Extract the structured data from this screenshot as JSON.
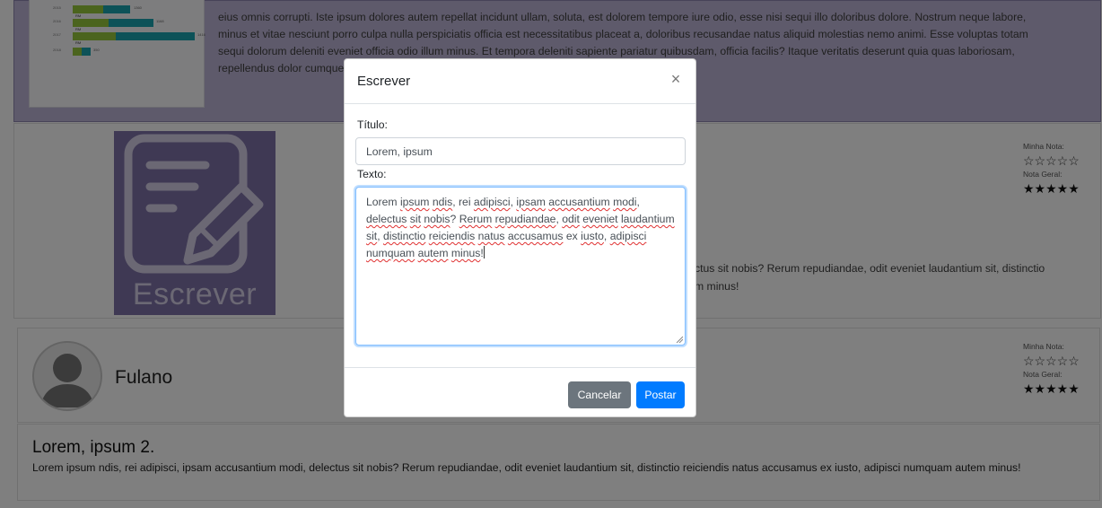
{
  "background": {
    "top_card": {
      "chart_thumbnail_rows": [
        {
          "year": "2015",
          "green": "RM",
          "value": "1360"
        },
        {
          "year": "2016",
          "green": "RM",
          "value": "1168"
        },
        {
          "year": "2017",
          "green": "RM",
          "value": "1416"
        },
        {
          "year": "2018",
          "green": "RM",
          "value": "350"
        }
      ],
      "text_lines": [
        "eius omnis corrupti. Iste ipsum dolores autem repellat incidunt ullam, soluta, est dolorem tempore iure odio, esse nisi sequi illo doloribus dolore. Nostrum neque labore,",
        "minus et vitae nesciunt porro culpa nulla perspiciatis officia est necessitatibus placeat a, doloribus recusandae natus aliquid molestias nemo animi. Esse voluptas totam",
        "sequi dolorum deleniti eveniet officia odio illum minus. Et tempora deleniti sapiente pariatur quibusdam, officia facilis? Itaque veritatis deserunt quia quas laboriosam,",
        "repellendus dolor cumque"
      ]
    },
    "escrever_logo_text": "Escrever",
    "review_card": {
      "minha_nota_label": "Minha Nota:",
      "minha_nota_stars": "☆☆☆☆☆",
      "nota_geral_label": "Nota Geral:",
      "nota_geral_stars": "★★★★★",
      "body_line_1": "ctus sit nobis? Rerum repudiandae, odit eveniet laudantium sit, distinctio",
      "body_line_2": "m minus!"
    },
    "user_card": {
      "name": "Fulano",
      "minha_nota_label": "Minha Nota:",
      "minha_nota_stars": "☆☆☆☆☆",
      "nota_geral_label": "Nota Geral:",
      "nota_geral_stars": "★★★★★"
    },
    "post": {
      "title": "Lorem, ipsum 2.",
      "text": "Lorem ipsum ndis, rei adipisci, ipsam accusantium modi, delectus sit nobis? Rerum repudiandae, odit eveniet laudantium sit, distinctio reiciendis natus accusamus ex iusto, adipisci numquam autem minus!"
    }
  },
  "modal": {
    "title": "Escrever",
    "close_glyph": "×",
    "titulo_label": "Título:",
    "titulo_value": "Lorem, ipsum",
    "texto_label": "Texto:",
    "texto_value": "Lorem ipsum ndis, rei adipisci, ipsam accusantium modi, delectus sit nobis? Rerum repudiandae, odit eveniet laudantium sit, distinctio reiciendis natus accusamus ex iusto, adipisci numquam autem minus!",
    "cancel_label": "Cancelar",
    "post_label": "Postar"
  },
  "colors": {
    "accent_purple": "#7f73a8",
    "primary_blue": "#007bff",
    "secondary_gray": "#6c757d"
  }
}
